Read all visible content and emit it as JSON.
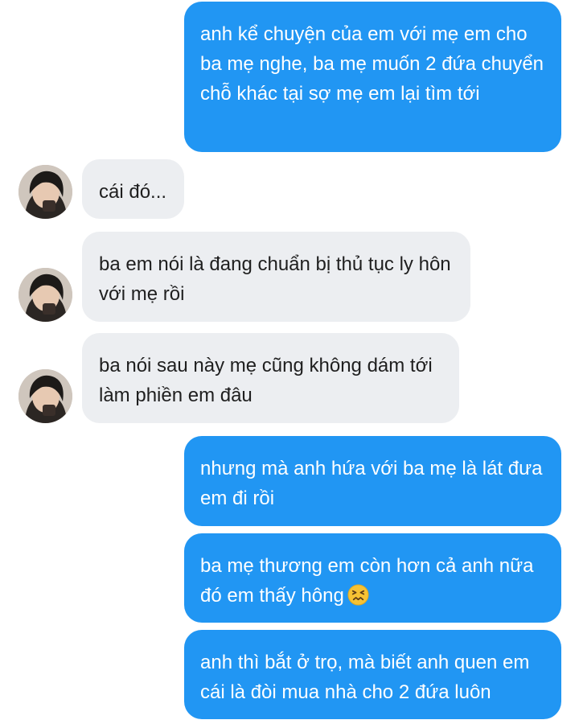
{
  "conversation": {
    "messages": [
      {
        "sender": "me",
        "text": "anh kể chuyện của em với mẹ em cho ba mẹ nghe, ba mẹ muốn 2 đứa chuyển chỗ khác tại sợ mẹ em lại tìm tới"
      },
      {
        "sender": "them",
        "text": "cái đó..."
      },
      {
        "sender": "them",
        "text": "ba em nói là đang chuẩn bị thủ tục ly hôn với mẹ rồi"
      },
      {
        "sender": "them",
        "text": "ba nói sau này mẹ cũng không dám tới làm phiền em đâu"
      },
      {
        "sender": "me",
        "text": "nhưng mà anh hứa với ba mẹ là lát đưa em đi rồi"
      },
      {
        "sender": "me",
        "text": "ba mẹ thương em còn hơn cả anh nữa đó em thấy hông",
        "emoji": "confounded-face-icon"
      },
      {
        "sender": "me",
        "text": "anh thì bắt ở trọ, mà biết anh quen em cái là đòi mua nhà cho 2 đứa luôn"
      }
    ]
  },
  "colors": {
    "outgoing_bubble": "#2196f3",
    "incoming_bubble": "#eceef1",
    "outgoing_text": "#ffffff",
    "incoming_text": "#1f1f1f",
    "emoji": "#f6c234"
  }
}
